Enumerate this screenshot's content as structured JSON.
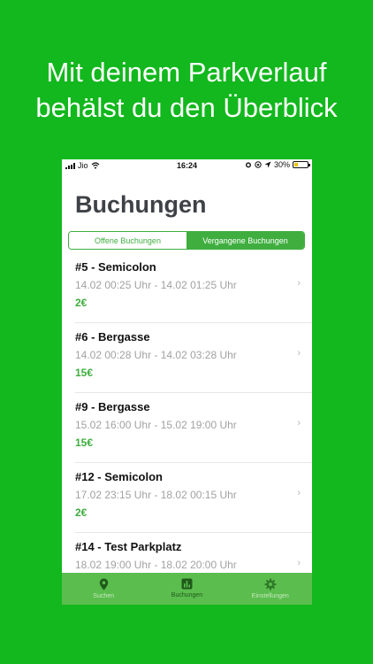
{
  "headline": {
    "line1": "Mit deinem Parkverlauf",
    "line2": "behälst du den Überblick"
  },
  "statusbar": {
    "carrier": "Jio",
    "time": "16:24",
    "battery": "30%",
    "battery_level": 0.3
  },
  "page": {
    "title": "Buchungen"
  },
  "tabs": {
    "open": "Offene Buchungen",
    "past": "Vergangene Buchungen",
    "active": "past"
  },
  "bookings": [
    {
      "name": "#5 - Semicolon",
      "time": "14.02 00:25 Uhr - 14.02 01:25 Uhr",
      "price": "2€"
    },
    {
      "name": "#6 - Bergasse",
      "time": "14.02 00:28 Uhr - 14.02 03:28 Uhr",
      "price": "15€"
    },
    {
      "name": "#9 - Bergasse",
      "time": "15.02 16:00 Uhr - 15.02 19:00 Uhr",
      "price": "15€"
    },
    {
      "name": "#12 - Semicolon",
      "time": "17.02 23:15 Uhr - 18.02 00:15 Uhr",
      "price": "2€"
    },
    {
      "name": "#14 - Test Parkplatz",
      "time": "18.02 19:00 Uhr - 18.02 20:00 Uhr",
      "price": ""
    }
  ],
  "chevron": "›",
  "nav": {
    "search": "Suchen",
    "bookings": "Buchungen",
    "settings": "Einstellungen",
    "active": "bookings"
  },
  "colors": {
    "background": "#12b81d",
    "accent": "#3fae3f",
    "tabbar": "#5bbd4e"
  },
  "icons": {
    "search": "map-pin-icon",
    "bookings": "bar-chart-icon",
    "settings": "gear-icon"
  }
}
